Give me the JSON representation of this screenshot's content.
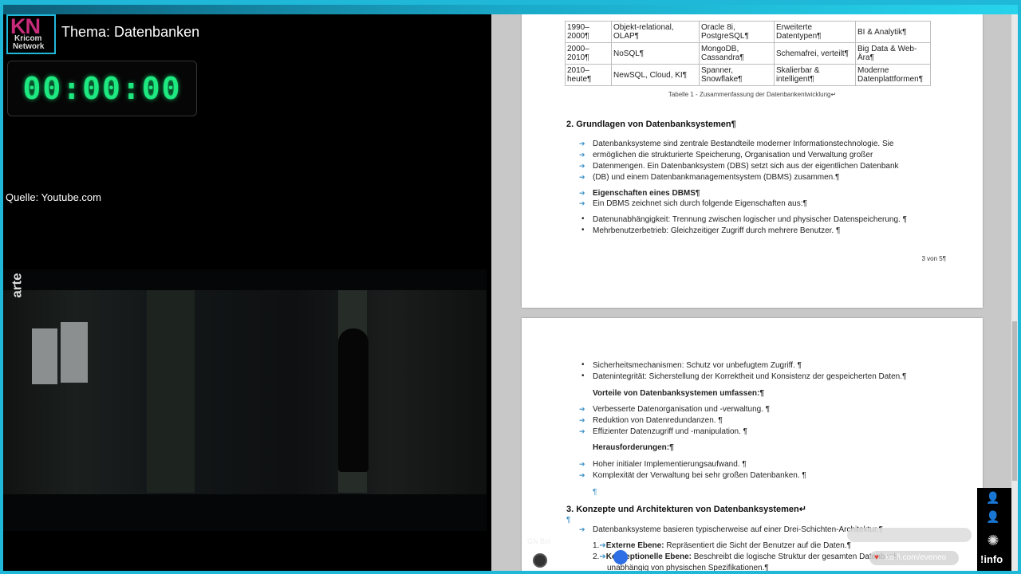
{
  "logo": {
    "mark": "KN",
    "line1": "Kricom",
    "line2": "Network"
  },
  "theme": "Thema: Datenbanken",
  "timer": "00:00:00",
  "source": "Quelle: Youtube.com",
  "video": {
    "watermark": "arte",
    "watermark_small": "arte"
  },
  "table": {
    "rows": [
      [
        "1990–2000¶",
        "Objekt-relational, OLAP¶",
        "Oracle 8i, PostgreSQL¶",
        "Erweiterte Datentypen¶",
        "BI & Analytik¶"
      ],
      [
        "2000–2010¶",
        "NoSQL¶",
        "MongoDB, Cassandra¶",
        "Schemafrei, verteilt¶",
        "Big Data & Web-Ära¶"
      ],
      [
        "2010–heute¶",
        "NewSQL, Cloud, KI¶",
        "Spanner, Snowflake¶",
        "Skalierbar & intelligent¶",
        "Moderne Datenplattformen¶"
      ]
    ],
    "caption": "Tabelle 1 - Zusammenfassung der Datenbankentwicklung↵"
  },
  "page1": {
    "heading": "2. Grundlagen von Datenbanksystemen¶",
    "intro_lines": [
      "Datenbanksysteme sind zentrale Bestandteile moderner Informationstechnologie. Sie",
      "ermöglichen die strukturierte Speicherung, Organisation und Verwaltung großer",
      "Datenmengen. Ein Datenbanksystem (DBS) setzt sich aus der eigentlichen Datenbank",
      "(DB) und einem Datenbankmanagementsystem (DBMS) zusammen.¶"
    ],
    "props_heading": "Eigenschaften eines DBMS¶",
    "props_intro": "Ein DBMS zeichnet sich durch folgende Eigenschaften aus:¶",
    "bullets": [
      "Datenunabhängigkeit: Trennung zwischen logischer und physischer Datenspeicherung. ¶",
      "Mehrbenutzerbetrieb: Gleichzeitiger Zugriff durch mehrere Benutzer. ¶"
    ],
    "page_number": "3 von 5¶"
  },
  "page2": {
    "bullets": [
      "Sicherheitsmechanismen: Schutz vor unbefugtem Zugriff. ¶",
      "Datenintegrität: Sicherstellung der Korrektheit und Konsistenz der gespeicherten Daten.¶"
    ],
    "adv_heading": "Vorteile von Datenbanksystemen umfassen:¶",
    "adv_items": [
      "Verbesserte Datenorganisation und -verwaltung. ¶",
      "Reduktion von Datenredundanzen. ¶",
      "Effizienter Datenzugriff und -manipulation. ¶"
    ],
    "chal_heading": "Herausforderungen:¶",
    "chal_items": [
      "Hoher initialer Implementierungsaufwand. ¶",
      "Komplexität der Verwaltung bei sehr großen Datenbanken. ¶"
    ],
    "heading3": "3. Konzepte und Architekturen von Datenbanksystemen↵",
    "arch_intro": "Datenbanksysteme basieren typischerweise auf einer Drei-Schichten-Architektur.¶",
    "arch_items": [
      {
        "num": "1.",
        "label": "Externe Ebene:",
        "text": " Repräsentiert die Sicht der Benutzer auf die Daten.¶"
      },
      {
        "num": "2.",
        "label": "Konzeptionelle Ebene:",
        "text": " Beschreibt die logische Struktur der gesamten Datenbank,"
      }
    ],
    "arch_cont": "unabhängig von physischen Spezifikationen.¶"
  },
  "overlay": {
    "chat_link": "ko-fi.com/eveneo",
    "info_label": "!info",
    "gn_label": "GN Bot"
  }
}
